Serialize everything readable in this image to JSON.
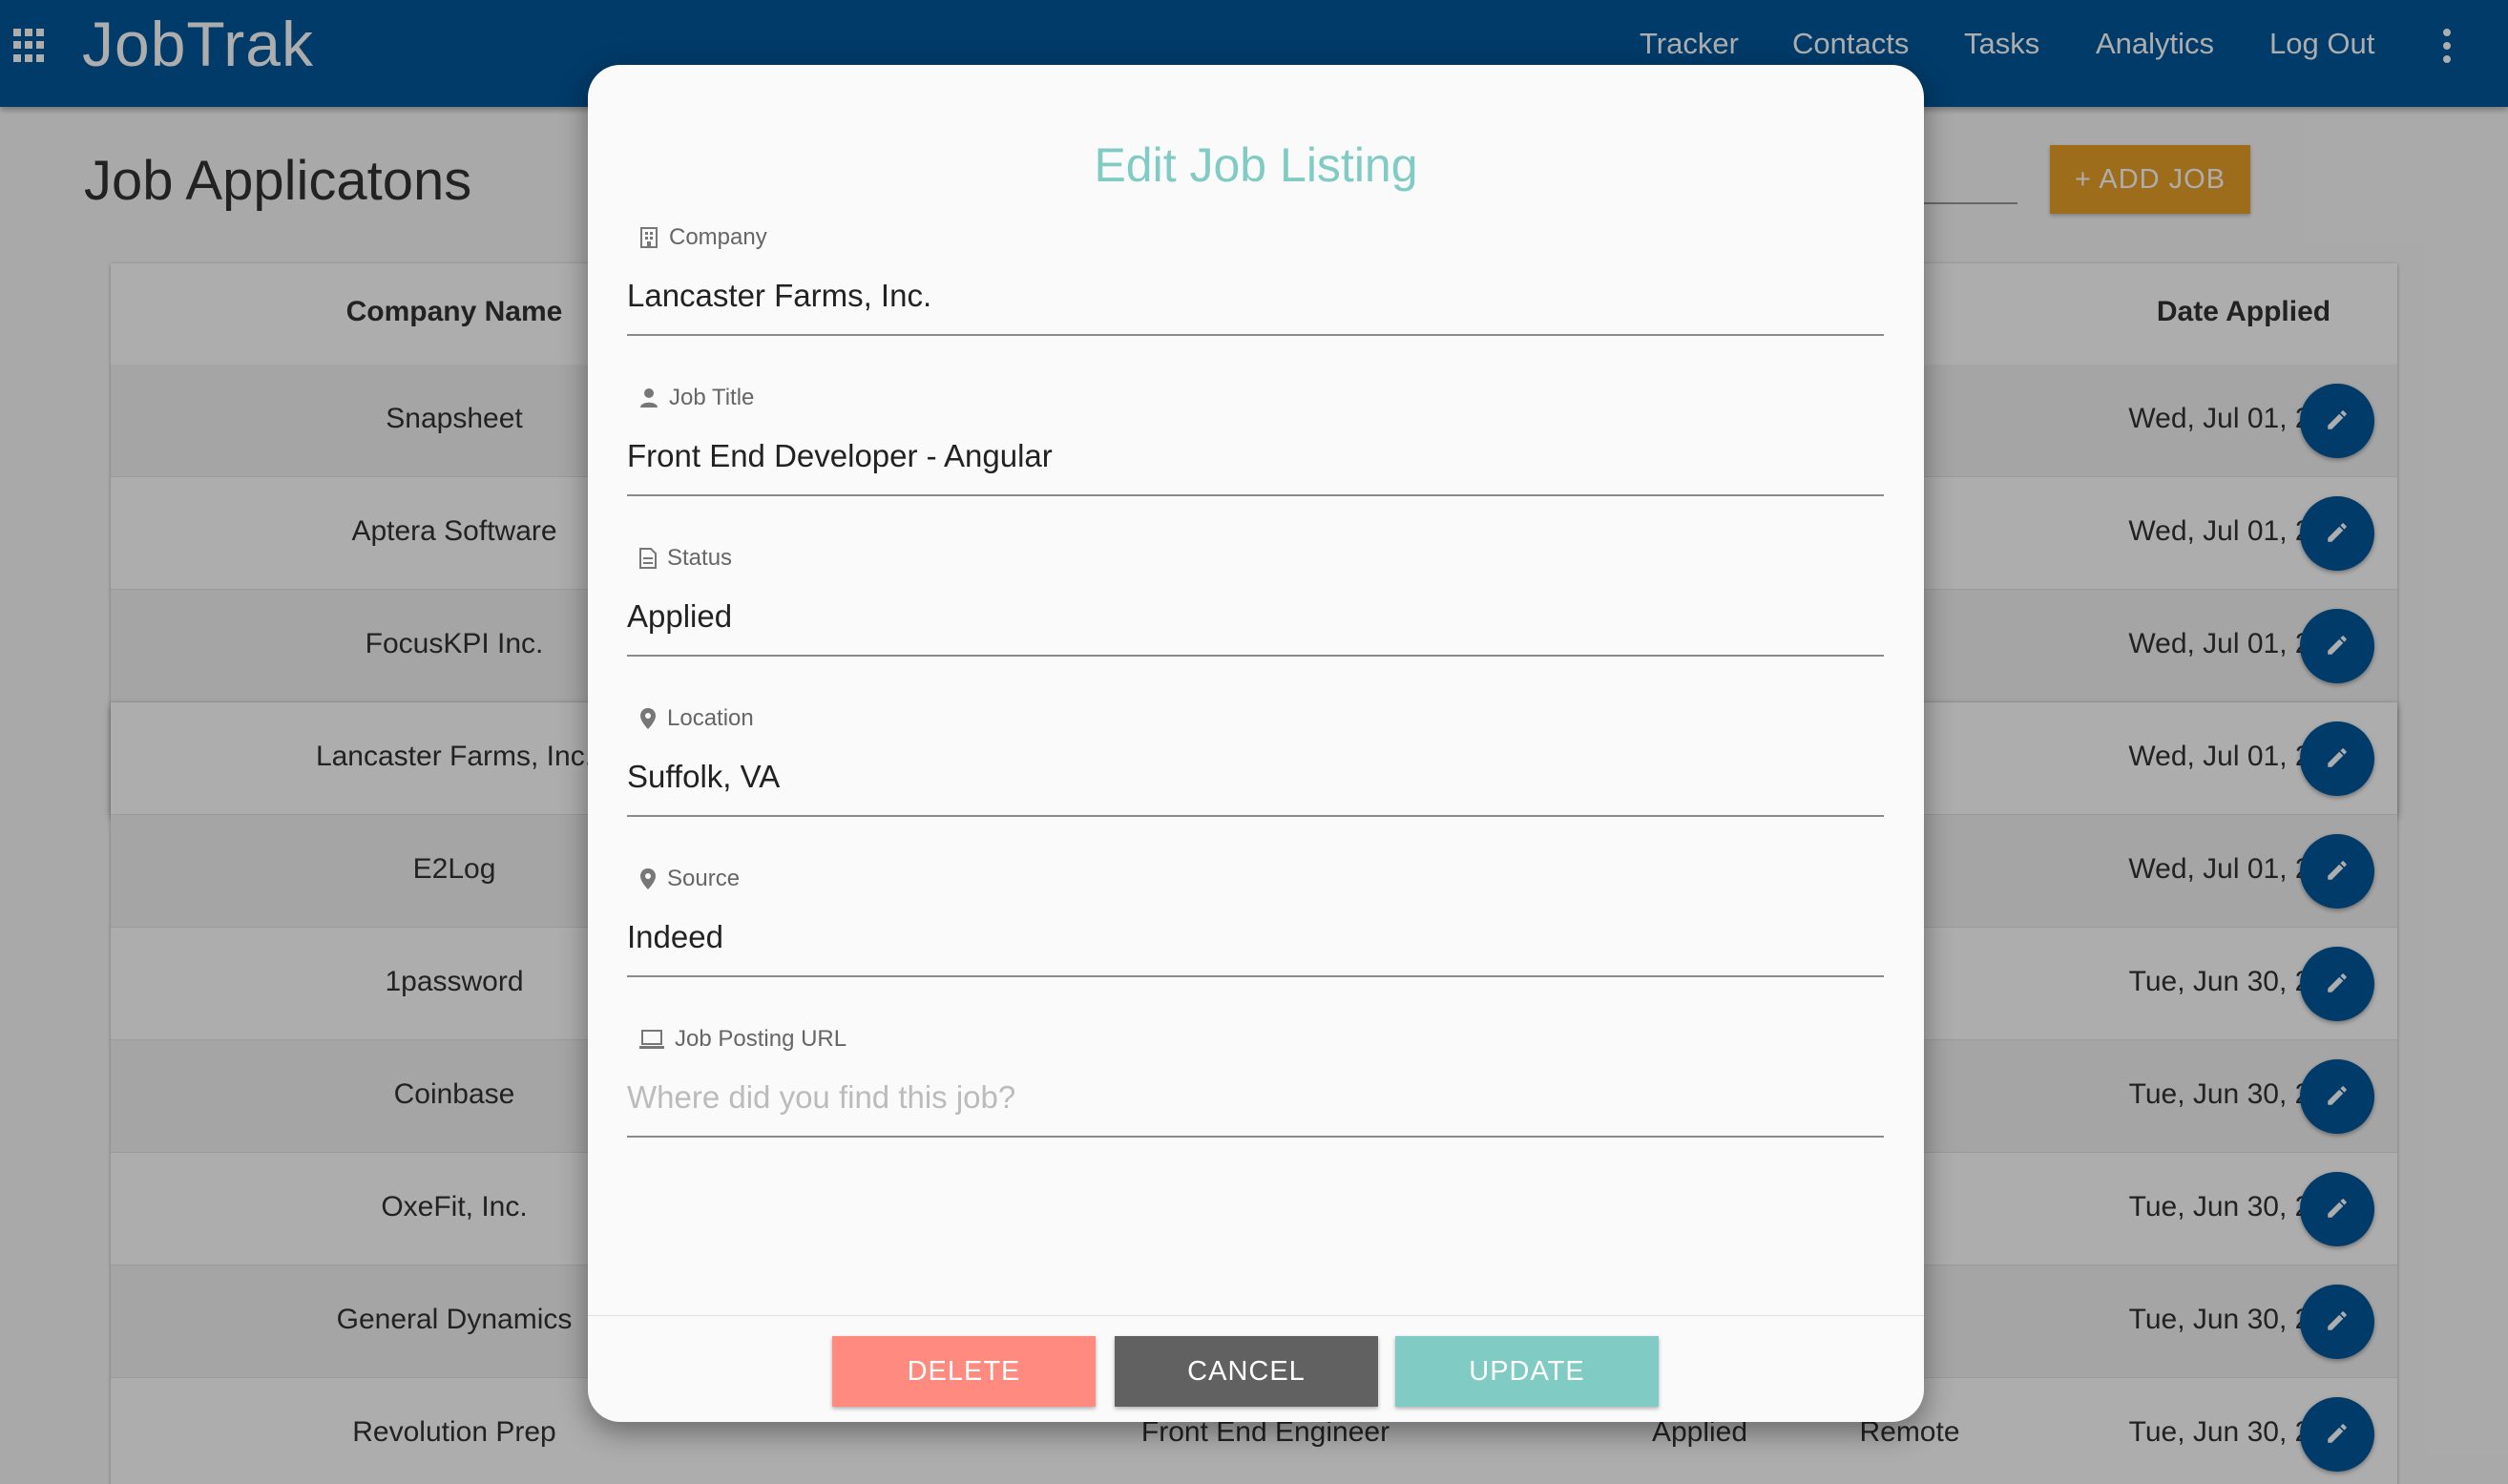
{
  "app": {
    "brand": "JobTrak",
    "nav": [
      "Tracker",
      "Contacts",
      "Tasks",
      "Analytics",
      "Log Out"
    ]
  },
  "page": {
    "title": "Job Applicatons",
    "add_job_label": "+ ADD JOB"
  },
  "table": {
    "headers": {
      "company": "Company Name",
      "date": "Date Applied"
    },
    "rows": [
      {
        "company": "Snapsheet",
        "date": "Wed, Jul 01, 2020"
      },
      {
        "company": "Aptera Software",
        "date": "Wed, Jul 01, 2020"
      },
      {
        "company": "FocusKPI Inc.",
        "date": "Wed, Jul 01, 2020"
      },
      {
        "company": "Lancaster Farms, Inc.",
        "date": "Wed, Jul 01, 2020"
      },
      {
        "company": "E2Log",
        "date": "Wed, Jul 01, 2020"
      },
      {
        "company": "1password",
        "date": "Tue, Jun 30, 2020"
      },
      {
        "company": "Coinbase",
        "date": "Tue, Jun 30, 2020"
      },
      {
        "company": "OxeFit, Inc.",
        "date": "Tue, Jun 30, 2020"
      },
      {
        "company": "General Dynamics",
        "date": "Tue, Jun 30, 2020"
      },
      {
        "company": "Revolution Prep",
        "title": "Front End Engineer",
        "status": "Applied",
        "location": "Remote",
        "date": "Tue, Jun 30, 2020"
      }
    ]
  },
  "dialog": {
    "title": "Edit Job Listing",
    "fields": {
      "company": {
        "label": "Company",
        "value": "Lancaster Farms, Inc.",
        "icon": "building-icon"
      },
      "job_title": {
        "label": "Job Title",
        "value": "Front End Developer - Angular",
        "icon": "person-icon"
      },
      "status": {
        "label": "Status",
        "value": "Applied",
        "icon": "document-icon"
      },
      "location": {
        "label": "Location",
        "value": "Suffolk, VA",
        "icon": "location-pin-icon"
      },
      "source": {
        "label": "Source",
        "value": "Indeed",
        "icon": "location-pin-icon"
      },
      "url": {
        "label": "Job Posting URL",
        "value": "",
        "placeholder": "Where did you find this job?",
        "icon": "laptop-icon"
      }
    },
    "buttons": {
      "delete": "DELETE",
      "cancel": "CANCEL",
      "update": "UPDATE"
    }
  },
  "colors": {
    "primary": "#01579b",
    "accent_orange": "#e8a129",
    "teal": "#80cbc4",
    "delete_red": "#ff8a80",
    "cancel_gray": "#616161"
  }
}
